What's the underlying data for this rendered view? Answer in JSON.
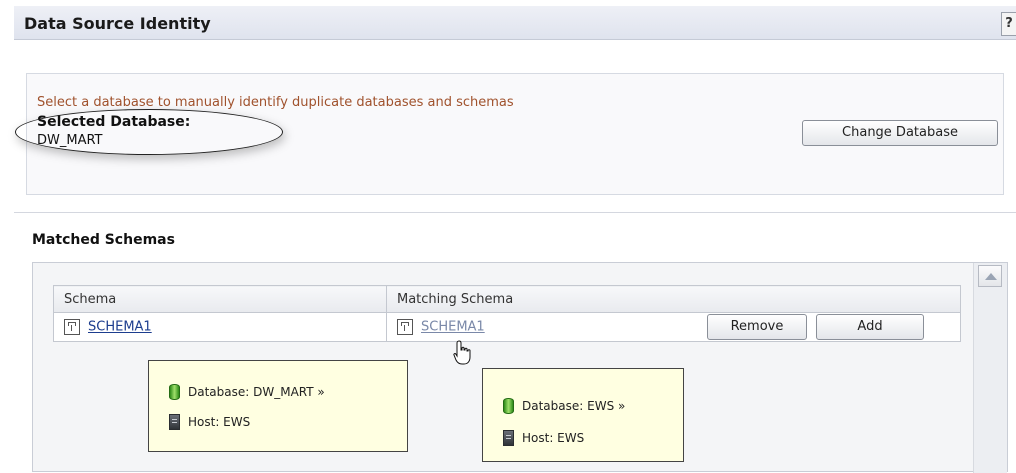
{
  "header": {
    "title": "Data Source Identity",
    "help_label": "?"
  },
  "database": {
    "instruction": "Select a database to manually identify duplicate databases and schemas",
    "selected_label": "Selected Database:",
    "selected_value": "DW_MART",
    "change_button": "Change Database"
  },
  "matched": {
    "title": "Matched Schemas",
    "columns": [
      "Schema",
      "Matching Schema"
    ],
    "rows": [
      {
        "schema": "SCHEMA1",
        "matching": "SCHEMA1",
        "remove_label": "Remove",
        "add_label": "Add"
      }
    ]
  },
  "tooltips": [
    {
      "database": "Database: DW_MART »",
      "host": "Host: EWS"
    },
    {
      "database": "Database: EWS »",
      "host": "Host: EWS"
    }
  ],
  "icons": {
    "schema": "schema-icon",
    "database": "database-icon",
    "host": "server-icon",
    "cursor": "hand-cursor-icon",
    "scroll": "scroll-up-arrow-icon"
  },
  "colors": {
    "instruction_text": "#a0522d",
    "link": "#1c3d8e",
    "tooltip_bg": "#ffffe1"
  }
}
